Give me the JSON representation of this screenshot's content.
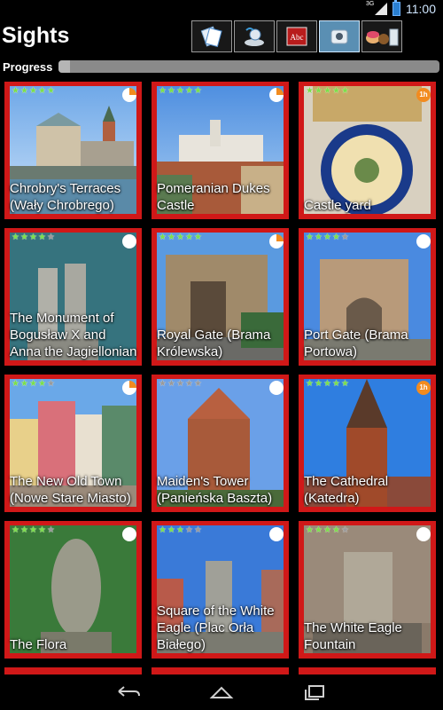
{
  "status_bar": {
    "network": "3G",
    "time": "11:00"
  },
  "action_bar": {
    "title": "Sights",
    "tabs": [
      {
        "icon": "map-pages-icon",
        "active": false
      },
      {
        "icon": "location-pin-icon",
        "active": false
      },
      {
        "icon": "phrasebook-icon",
        "active": false,
        "text": "Abc"
      },
      {
        "icon": "camera-icon",
        "active": true
      },
      {
        "icon": "food-drink-icon",
        "active": false
      }
    ]
  },
  "progress": {
    "label": "Progress",
    "value": 0.03
  },
  "sights": [
    {
      "name": "Chrobry's Terraces (Wały Chrobrego)",
      "stars": 5,
      "badge": "pie"
    },
    {
      "name": "Pomeranian Dukes Castle",
      "stars": 5,
      "badge": "pie"
    },
    {
      "name": "Castle yard",
      "stars": 5,
      "badge": "hour",
      "badge_text": "1h"
    },
    {
      "name": "The Monument of Bogusław X  and Anna the Jagiellonian",
      "stars": 4,
      "badge": "empty"
    },
    {
      "name": "Royal Gate (Brama Królewska)",
      "stars": 5,
      "badge": "pie"
    },
    {
      "name": "Port Gate (Brama Portowa)",
      "stars": 4,
      "badge": "empty"
    },
    {
      "name": "The New Old Town (Nowe Stare Miasto)",
      "stars": 4,
      "badge": "pie"
    },
    {
      "name": "Maiden's Tower (Panieńska Baszta)",
      "stars": 0,
      "badge": "empty"
    },
    {
      "name": "The Cathedral (Katedra)",
      "stars": 5,
      "badge": "hour",
      "badge_text": "1h"
    },
    {
      "name": "The Flora",
      "stars": 4,
      "badge": "empty"
    },
    {
      "name": "Square of the White Eagle (Plac Orła Białego)",
      "stars": 3,
      "badge": "empty"
    },
    {
      "name": "The White Eagle Fountain",
      "stars": 4,
      "badge": "empty"
    }
  ]
}
